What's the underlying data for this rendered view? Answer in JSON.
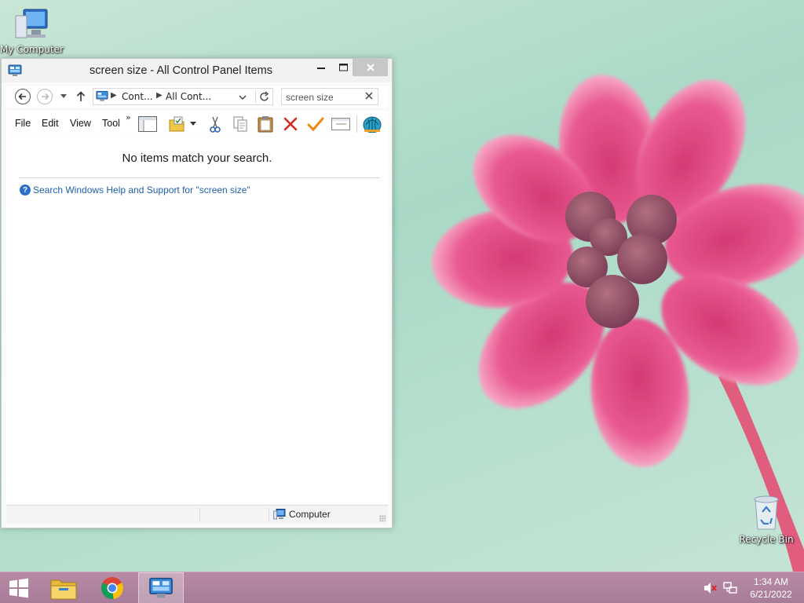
{
  "desktop": {
    "icons": [
      {
        "label": "My Computer",
        "icon": "computer-icon"
      },
      {
        "label": "Recycle Bin",
        "icon": "recycle-bin-icon"
      }
    ]
  },
  "window": {
    "title": "screen size - All Control Panel Items",
    "app_icon": "control-panel-icon",
    "caption_buttons": [
      "minimize",
      "maximize",
      "close"
    ],
    "nav": {
      "back_icon": "back-arrow-icon",
      "forward_icon": "forward-arrow-icon",
      "up_icon": "up-arrow-icon"
    },
    "address": {
      "crumbs": [
        "Cont...",
        "All Cont..."
      ],
      "refresh_icon": "refresh-icon"
    },
    "search": {
      "value": "screen size",
      "clear_icon": "close-icon"
    },
    "menu": {
      "file": "File",
      "edit": "Edit",
      "view": "View",
      "tools": "Tools",
      "overflow": "»"
    },
    "toolbar_icons": [
      "layout-pane-icon",
      "folder-icon",
      "cut-icon",
      "copy-icon",
      "paste-icon",
      "delete-icon",
      "check-icon",
      "properties-icon",
      "shell-icon"
    ],
    "content": {
      "empty_message": "No items match your search.",
      "help_link": "Search Windows Help and Support for \"screen size\""
    },
    "statusbar": {
      "zone": "Computer"
    }
  },
  "taskbar": {
    "apps": [
      "start",
      "file-explorer",
      "chrome",
      "control-panel"
    ],
    "active_app": "control-panel",
    "clock": {
      "time": "1:34 AM",
      "date": "6/21/2022"
    },
    "tray": [
      "volume-muted-icon",
      "network-icon"
    ]
  },
  "colors": {
    "taskbar": "#b08aa2",
    "link": "#1f5fa8",
    "close_button": "#c7c7c7",
    "wallpaper_bg": "#b5dfcc",
    "flower": "#e0457e"
  }
}
